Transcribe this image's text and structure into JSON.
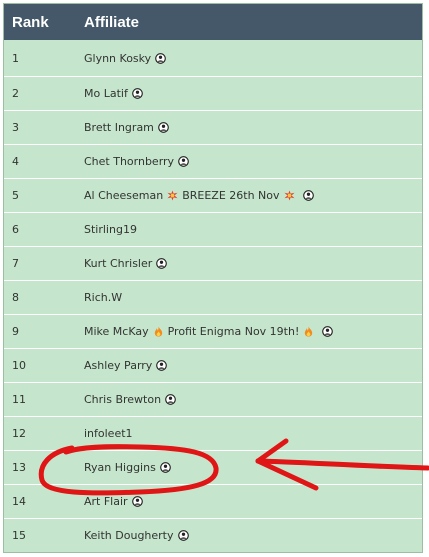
{
  "header": {
    "rank": "Rank",
    "affiliate": "Affiliate"
  },
  "rows": [
    {
      "rank": "1",
      "name": "Glynn Kosky",
      "mid_text": "",
      "emoji": "",
      "person": true
    },
    {
      "rank": "2",
      "name": "Mo Latif",
      "mid_text": "",
      "emoji": "",
      "person": true
    },
    {
      "rank": "3",
      "name": "Brett Ingram",
      "mid_text": "",
      "emoji": "",
      "person": true
    },
    {
      "rank": "4",
      "name": "Chet Thornberry",
      "mid_text": "",
      "emoji": "",
      "person": true
    },
    {
      "rank": "5",
      "name": "Al Cheeseman",
      "mid_text": "BREEZE 26th Nov",
      "emoji": "collision-icon",
      "person": true
    },
    {
      "rank": "6",
      "name": "Stirling19",
      "mid_text": "",
      "emoji": "",
      "person": false
    },
    {
      "rank": "7",
      "name": "Kurt Chrisler",
      "mid_text": "",
      "emoji": "",
      "person": true
    },
    {
      "rank": "8",
      "name": "Rich.W",
      "mid_text": "",
      "emoji": "",
      "person": false
    },
    {
      "rank": "9",
      "name": "Mike McKay",
      "mid_text": "Profit Enigma Nov 19th!",
      "emoji": "fire-icon",
      "person": true
    },
    {
      "rank": "10",
      "name": "Ashley Parry",
      "mid_text": "",
      "emoji": "",
      "person": true
    },
    {
      "rank": "11",
      "name": "Chris Brewton",
      "mid_text": "",
      "emoji": "",
      "person": true
    },
    {
      "rank": "12",
      "name": "infoleet1",
      "mid_text": "",
      "emoji": "",
      "person": false
    },
    {
      "rank": "13",
      "name": "Ryan Higgins",
      "mid_text": "",
      "emoji": "",
      "person": true
    },
    {
      "rank": "14",
      "name": "Art Flair",
      "mid_text": "",
      "emoji": "",
      "person": true
    },
    {
      "rank": "15",
      "name": "Keith Dougherty",
      "mid_text": "",
      "emoji": "",
      "person": true
    }
  ],
  "colors": {
    "header_bg": "#445869",
    "row_bg": "#c5e6cc",
    "annotation": "#e01515"
  }
}
